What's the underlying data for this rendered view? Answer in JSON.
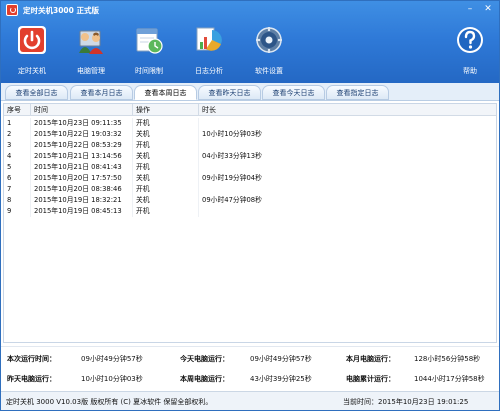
{
  "window": {
    "title": "定时关机3000 正式版",
    "min_glyph": "–",
    "close_glyph": "✕"
  },
  "toolbar": {
    "items": [
      {
        "label": "定时关机",
        "icon": "power-icon"
      },
      {
        "label": "电脑管理",
        "icon": "users-icon"
      },
      {
        "label": "时间限制",
        "icon": "clock-icon"
      },
      {
        "label": "日志分析",
        "icon": "chart-icon"
      },
      {
        "label": "软件设置",
        "icon": "gear-icon"
      },
      {
        "label": "帮助",
        "icon": "help-icon"
      }
    ]
  },
  "tabs": [
    {
      "label": "查看全部日志",
      "active": false
    },
    {
      "label": "查看本月日志",
      "active": false
    },
    {
      "label": "查看本周日志",
      "active": true
    },
    {
      "label": "查看昨天日志",
      "active": false
    },
    {
      "label": "查看今天日志",
      "active": false
    },
    {
      "label": "查看指定日志",
      "active": false
    }
  ],
  "log": {
    "headers": {
      "no": "序号",
      "time": "时间",
      "op": "操作",
      "dur": "时长"
    },
    "rows": [
      {
        "no": "1",
        "time": "2015年10月23日 09:11:35",
        "op": "开机",
        "dur": ""
      },
      {
        "no": "2",
        "time": "2015年10月22日 19:03:32",
        "op": "关机",
        "dur": "10小时10分钟03秒"
      },
      {
        "no": "3",
        "time": "2015年10月22日 08:53:29",
        "op": "开机",
        "dur": ""
      },
      {
        "no": "4",
        "time": "2015年10月21日 13:14:56",
        "op": "关机",
        "dur": "04小时33分钟13秒"
      },
      {
        "no": "5",
        "time": "2015年10月21日 08:41:43",
        "op": "开机",
        "dur": ""
      },
      {
        "no": "6",
        "time": "2015年10月20日 17:57:50",
        "op": "关机",
        "dur": "09小时19分钟04秒"
      },
      {
        "no": "7",
        "time": "2015年10月20日 08:38:46",
        "op": "开机",
        "dur": ""
      },
      {
        "no": "8",
        "time": "2015年10月19日 18:32:21",
        "op": "关机",
        "dur": "09小时47分钟08秒"
      },
      {
        "no": "9",
        "time": "2015年10月19日 08:45:13",
        "op": "开机",
        "dur": ""
      }
    ]
  },
  "stats": {
    "this_run_label": "本次运行时间：",
    "this_run_value": "09小时49分钟57秒",
    "today_label": "今天电脑运行：",
    "today_value": "09小时49分钟57秒",
    "month_label": "本月电脑运行：",
    "month_value": "128小时56分钟58秒",
    "yesterday_label": "昨天电脑运行：",
    "yesterday_value": "10小时10分钟03秒",
    "week_label": "本周电脑运行：",
    "week_value": "43小时39分钟25秒",
    "total_label": "电脑累计运行：",
    "total_value": "1044小时17分钟58秒"
  },
  "statusbar": {
    "version": "定时关机 3000 V10.03版 版权所有 (C) 夏冰软件 保留全部权利。",
    "current_time": "当前时间：2015年10月23日 19:01:25"
  },
  "colors": {
    "titlebar": "#2f7ad8",
    "power_red": "#e23f2d",
    "tab_bg": "#e4eef9"
  }
}
